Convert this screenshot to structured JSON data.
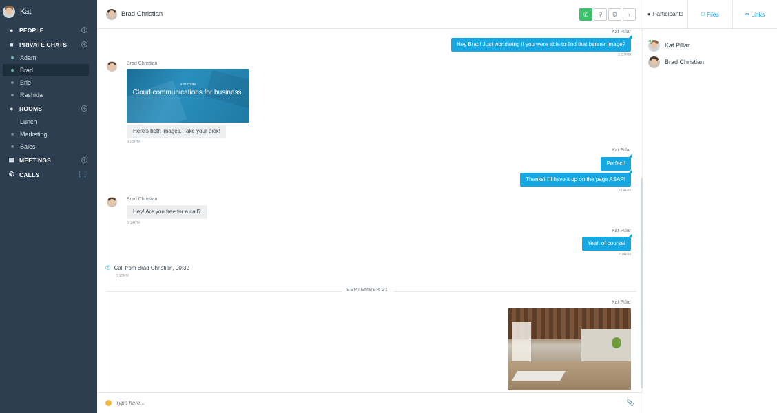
{
  "sidebar": {
    "user_name": "Kat",
    "sections": {
      "people": "PEOPLE",
      "private_chats": "PRIVATE CHATS",
      "rooms": "ROOMS",
      "meetings": "MEETINGS",
      "calls": "CALLS"
    },
    "private_chats": [
      "Adam",
      "Brad",
      "Brie",
      "Rashida"
    ],
    "rooms": [
      "Lunch",
      "Marketing",
      "Sales"
    ]
  },
  "chat": {
    "title": "Brad Christian",
    "messages": [
      {
        "sender": "Kat Pillar",
        "text": "Hey Brad! Just wondering if you were able to find that banner image?",
        "time": "2:57PM"
      },
      {
        "sender": "Brad Christian",
        "image_brand": "skrumble",
        "image_text": "Cloud communications for business.",
        "text": "Here's both images. Take your pick!",
        "time": "3:03PM"
      },
      {
        "sender": "Kat Pillar",
        "text": "Perfect!",
        "text2": "Thanks! I'll have it up on the page ASAP!",
        "time": "3:04PM"
      },
      {
        "sender": "Brad Christian",
        "text": "Hey! Are you free for a call?",
        "time": "3:14PM"
      },
      {
        "sender": "Kat Pillar",
        "text": "Yeah of course!",
        "time": "3:14PM"
      },
      {
        "call_text": "Call from Brad Christian, 00:32",
        "time": "3:15PM"
      },
      {
        "divider": "SEPTEMBER 21"
      },
      {
        "sender": "Kat Pillar",
        "image": "office-photo"
      }
    ]
  },
  "composer": {
    "placeholder": "Type here..."
  },
  "right_panel": {
    "tabs": [
      "Participants",
      "Files",
      "Links"
    ],
    "participants": [
      "Kat Pillar",
      "Brad Christian"
    ]
  },
  "colors": {
    "sidebar_bg": "#2c3e4f",
    "accent": "#17a8e1",
    "call_green": "#3cc06c"
  }
}
